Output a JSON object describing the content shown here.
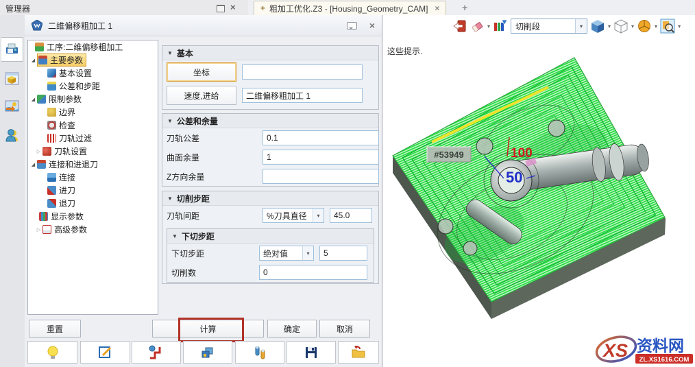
{
  "ui": {
    "collapse_marker": "▼",
    "dropdown_marker": "▾",
    "expanded_glyph": "◢",
    "collapsed_glyph": "▷"
  },
  "chrome": {
    "manager_title": "管理器",
    "close_glyph": "×",
    "tab": {
      "plus": "+",
      "title": "粗加工优化.Z3 - [Housing_Geometry_CAM]",
      "close": "×",
      "new_tab": "+"
    }
  },
  "sidebar": {
    "icons": [
      "output-manager-icon",
      "solid-geometry-icon",
      "render-image-icon",
      "user-assistant-icon"
    ]
  },
  "dialog": {
    "title": "二维偏移粗加工 1",
    "close": "×",
    "tree": [
      {
        "label": "工序:二维偏移粗加工",
        "expander": "",
        "icon": "operation-icon"
      },
      {
        "label": "主要参数",
        "expander": "◢",
        "icon": "main-params-icon",
        "selected": true
      },
      {
        "label": "基本设置",
        "expander": "",
        "icon": "basic-setup-icon"
      },
      {
        "label": "公差和步距",
        "expander": "",
        "icon": "tolerance-step-icon"
      },
      {
        "label": "限制参数",
        "expander": "◢",
        "icon": "limit-params-icon"
      },
      {
        "label": "边界",
        "expander": "",
        "icon": "boundary-icon"
      },
      {
        "label": "检查",
        "expander": "",
        "icon": "check-icon"
      },
      {
        "label": "刀轨过滤",
        "expander": "",
        "icon": "toolpath-filter-icon"
      },
      {
        "label": "刀轨设置",
        "expander": "▷",
        "icon": "toolpath-settings-icon"
      },
      {
        "label": "连接和进退刀",
        "expander": "◢",
        "icon": "link-retract-icon"
      },
      {
        "label": "连接",
        "expander": "",
        "icon": "link-icon"
      },
      {
        "label": "进刀",
        "expander": "",
        "icon": "lead-in-icon"
      },
      {
        "label": "退刀",
        "expander": "",
        "icon": "lead-out-icon"
      },
      {
        "label": "显示参数",
        "expander": "",
        "icon": "display-params-icon"
      },
      {
        "label": "高级参数",
        "expander": "▷",
        "icon": "advanced-params-icon"
      }
    ],
    "sections": {
      "basic": {
        "header": "基本",
        "coord_button": "坐标",
        "coord_value": "",
        "feed_button": "速度,进给",
        "name_value": "二维偏移粗加工 1"
      },
      "tolerance": {
        "header": "公差和余量",
        "rows": [
          {
            "label": "刀轨公差",
            "value": "0.1"
          },
          {
            "label": "曲面余量",
            "value": "1"
          },
          {
            "label": "Z方向余量",
            "value": ""
          }
        ]
      },
      "step": {
        "header": "切削步距",
        "spacing_label": "刀轨间距",
        "spacing_type": "%刀具直径",
        "spacing_value": "45.0",
        "stepdown": {
          "header": "下切步距",
          "label": "下切步距",
          "type": "绝对值",
          "value": "5",
          "cuts_label": "切削数",
          "cuts_value": "0"
        }
      }
    },
    "buttons": {
      "reset": "重置",
      "calculate": "计算",
      "ok": "确定",
      "cancel": "取消"
    },
    "bottom_icons": [
      "hint-bulb-icon",
      "edit-operation-icon",
      "lead-path-icon",
      "batch-calc-icon",
      "tool-manager-icon",
      "save-icon",
      "open-folder-icon"
    ]
  },
  "viewport": {
    "hint": "这些提示.",
    "toolbar": {
      "combo_value": "切削段",
      "icons": [
        "exit-icon",
        "eraser-icon",
        "color-filter-icon",
        "shaded-cube-icon",
        "wireframe-cube-icon",
        "pie-view-icon",
        "zoom-region-icon"
      ]
    },
    "labels": {
      "readout": "#53949",
      "dim_red": "100",
      "dim_blue": "50"
    }
  },
  "watermark": {
    "logo": "XS",
    "name": "资料网",
    "url": "ZL.XS1616.COM"
  },
  "colors": {
    "toolpath_green": "#1de23a",
    "toolpath_dark": "#0db030",
    "block_side": "#5d675c",
    "highlight_yellow": "#ece42c",
    "annotation_red": "#b23226",
    "select_orange": "#d89c34",
    "dim_red": "#cc1f1f",
    "dim_blue": "#1f2fc8"
  }
}
